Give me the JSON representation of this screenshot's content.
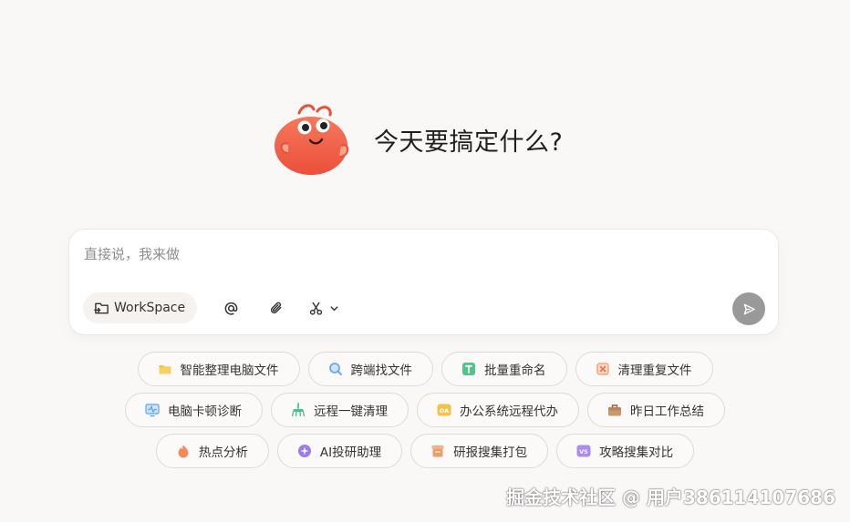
{
  "hero": {
    "title": "今天要搞定什么?"
  },
  "input": {
    "placeholder": "直接说，我来做",
    "value": ""
  },
  "toolbar": {
    "workspace_label": "WorkSpace",
    "icons": [
      "workspace-icon",
      "at-icon",
      "paperclip-icon",
      "scissors-icon",
      "chevron-down-icon",
      "send-icon"
    ]
  },
  "chips": {
    "row1": [
      {
        "label": "智能整理电脑文件",
        "icon": "folder-icon",
        "color": "#f5c343"
      },
      {
        "label": "跨端找文件",
        "icon": "search-icon",
        "color": "#6aa8f0"
      },
      {
        "label": "批量重命名",
        "icon": "rename-icon",
        "color": "#52c48a"
      },
      {
        "label": "清理重复文件",
        "icon": "duplicate-clean-icon",
        "color": "#f29a72"
      }
    ],
    "row2": [
      {
        "label": "电脑卡顿诊断",
        "icon": "monitor-pulse-icon",
        "color": "#5aa5ef"
      },
      {
        "label": "远程一键清理",
        "icon": "broom-icon",
        "color": "#4cc09a"
      },
      {
        "label": "办公系统远程代办",
        "icon": "oa-icon",
        "color": "#f5c343"
      },
      {
        "label": "昨日工作总结",
        "icon": "briefcase-icon",
        "color": "#b8845a"
      }
    ],
    "row3": [
      {
        "label": "热点分析",
        "icon": "flame-icon",
        "color": "#f38a5a"
      },
      {
        "label": "AI投研助理",
        "icon": "sparkle-icon",
        "color": "#9b7cf0"
      },
      {
        "label": "研报搜集打包",
        "icon": "package-icon",
        "color": "#f29a6a"
      },
      {
        "label": "攻略搜集对比",
        "icon": "vs-icon",
        "color": "#a88cf0"
      }
    ]
  },
  "watermark": "掘金技术社区 @ 用户386114107686",
  "colors": {
    "background": "#faf8f7",
    "send_button": "#999999",
    "mascot": "#f2634a"
  }
}
